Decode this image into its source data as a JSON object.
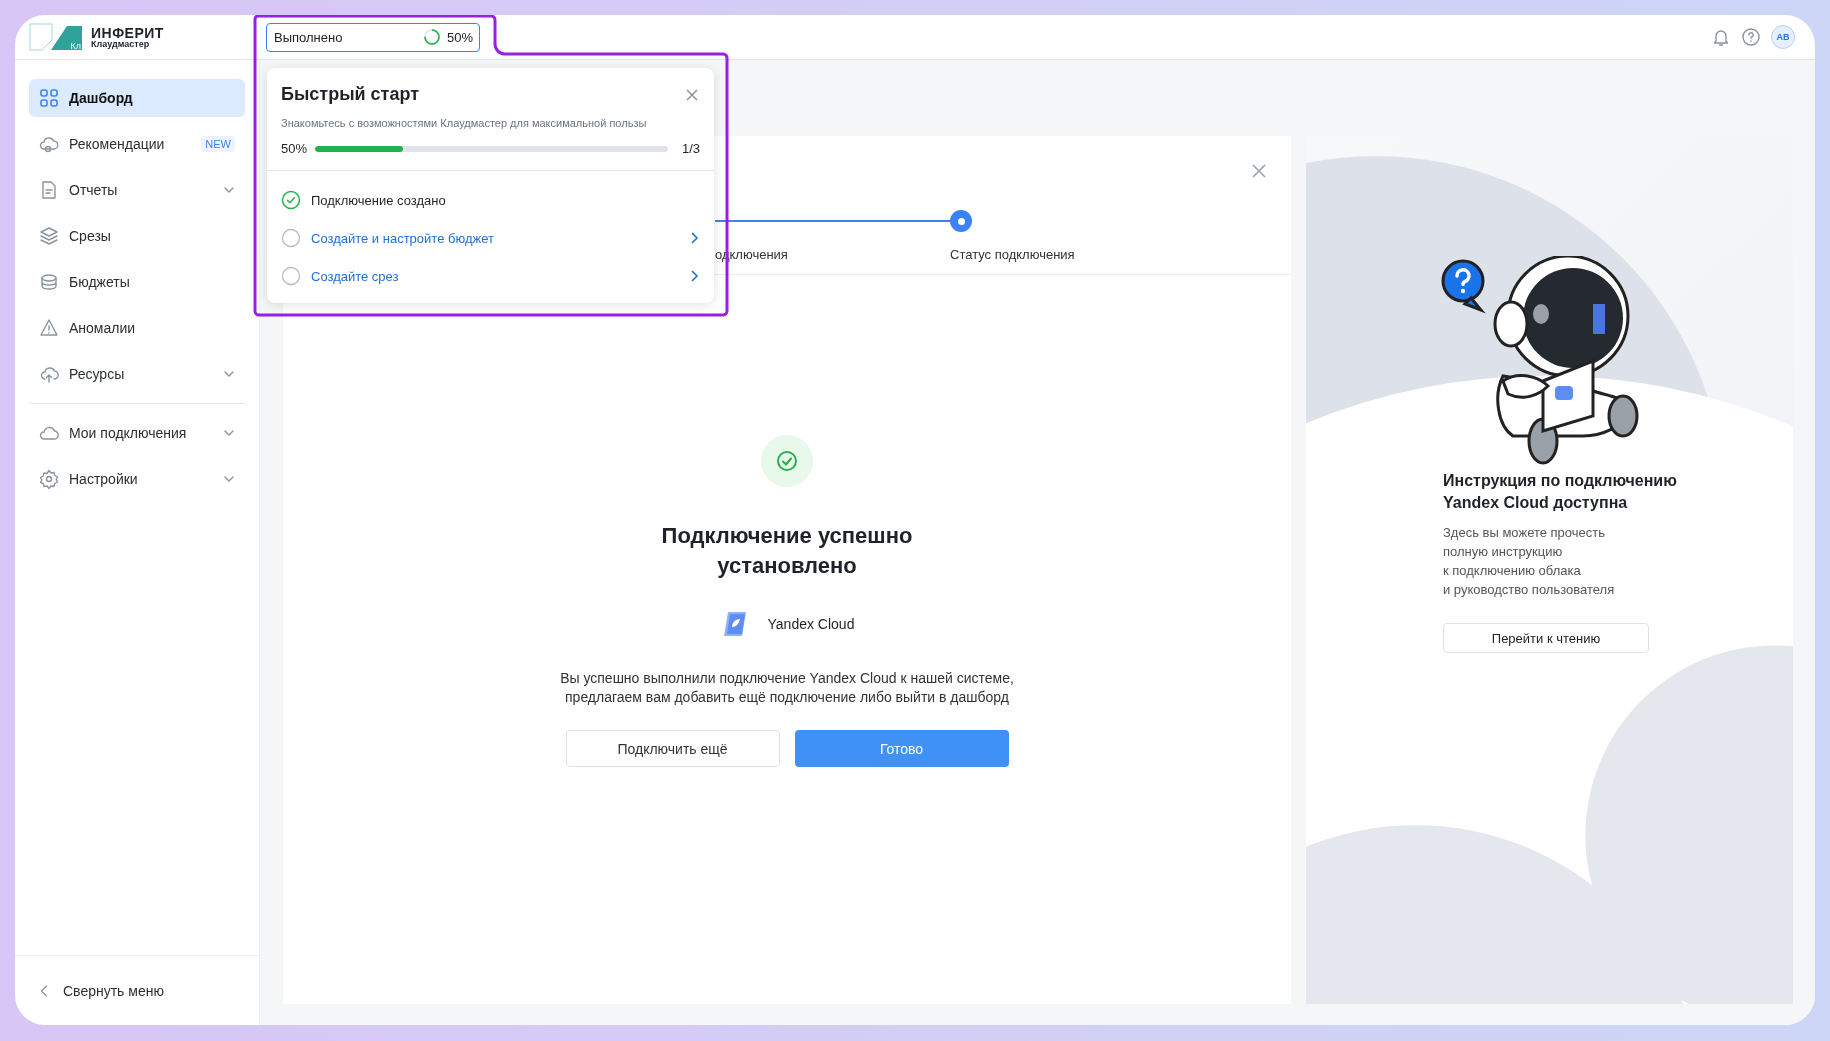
{
  "header": {
    "logo": {
      "mark": "Кл",
      "name": "ИНФЕРИТ",
      "product": "Клаудмастер"
    },
    "progress_chip": {
      "label": "Выполнено",
      "value": "50%"
    },
    "avatar": "AB"
  },
  "sidebar": {
    "groups": [
      {
        "items": [
          {
            "label": "Дашборд",
            "selected": true
          },
          {
            "label": "Рекомендации",
            "selected": false,
            "badge": "NEW"
          },
          {
            "label": "Отчеты",
            "selected": false,
            "expanded": false
          },
          {
            "label": "Срезы",
            "selected": false
          },
          {
            "label": "Бюджеты",
            "selected": false
          },
          {
            "label": "Аномалии",
            "selected": false
          },
          {
            "label": "Ресурсы",
            "selected": false,
            "expanded": false
          }
        ]
      },
      {
        "items": [
          {
            "label": "Мои подключения",
            "selected": false,
            "expanded": false
          },
          {
            "label": "Настройки",
            "selected": false,
            "expanded": false
          }
        ]
      }
    ],
    "collapse": "Свернуть меню"
  },
  "quick_start": {
    "title": "Быстрый старт",
    "subtitle": "Знакомьтесь с возможностями Клаудмастер для максимальной пользы",
    "percent": "50%",
    "level": 0.25,
    "count": "1/3",
    "tasks": [
      {
        "label": "Подключение создано",
        "checked": true
      },
      {
        "label": "Создайте и настройте бюджет",
        "checked": false
      },
      {
        "label": "Создайте срез",
        "checked": false
      }
    ]
  },
  "wizard": {
    "steps": [
      {
        "label": "одключения",
        "current": false
      },
      {
        "label": "Статус подключения",
        "current": true
      }
    ],
    "title": "Подключение успешно установлено",
    "provider": "Yandex Cloud",
    "message": "Вы успешно выполнили подключение Yandex Cloud к нашей системе, предлагаем вам добавить ещё подключение либо выйти в дашборд",
    "buttons": [
      {
        "label": "Подключить ещё",
        "kind": "secondary"
      },
      {
        "label": "Готово",
        "kind": "primary"
      }
    ]
  },
  "guide": {
    "title": "Инструкция по подключению Yandex Cloud доступна",
    "lines": [
      "Здесь вы можете прочесть",
      "полную инструкцию",
      "к подключению облака",
      "и руководство пользователя"
    ],
    "button": "Перейти к чтению"
  }
}
